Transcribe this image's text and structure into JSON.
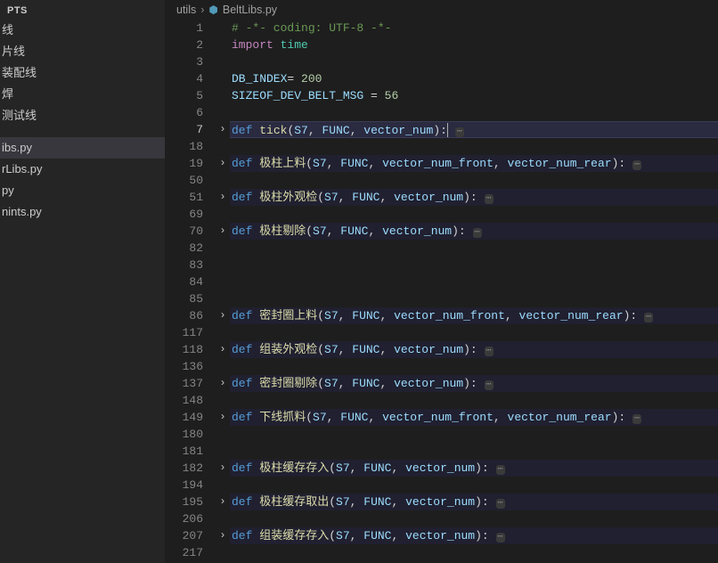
{
  "sidebar": {
    "header": "PTS",
    "items": [
      {
        "label": "线"
      },
      {
        "label": "片线"
      },
      {
        "label": "装配线"
      },
      {
        "label": "焊"
      },
      {
        "label": "测试线"
      },
      {
        "label": "ibs.py",
        "selected": true
      },
      {
        "label": "rLibs.py"
      },
      {
        "label": "py"
      },
      {
        "label": "nints.py"
      }
    ]
  },
  "breadcrumb": {
    "parent": "utils",
    "file": "BeltLibs.py"
  },
  "editor": {
    "lines": [
      {
        "n": 1,
        "type": "comment",
        "text": "# -*- coding: UTF-8 -*-"
      },
      {
        "n": 2,
        "type": "import",
        "kw": "import",
        "mod": "time"
      },
      {
        "n": 3,
        "type": "blank"
      },
      {
        "n": 4,
        "type": "assign",
        "var": "DB_INDEX",
        "val": "200",
        "op": "= "
      },
      {
        "n": 5,
        "type": "assign",
        "var": "SIZEOF_DEV_BELT_MSG",
        "val": "56",
        "op": " = "
      },
      {
        "n": 6,
        "type": "blank"
      },
      {
        "n": 7,
        "type": "def",
        "name": "tick",
        "params": "S7, FUNC, vector_num",
        "fold": true,
        "hl": true,
        "cursor": true
      },
      {
        "n": 18,
        "type": "blank"
      },
      {
        "n": 19,
        "type": "def",
        "name": "极柱上料",
        "params": "S7, FUNC, vector_num_front, vector_num_rear",
        "fold": true,
        "hl2": true
      },
      {
        "n": 50,
        "type": "blank"
      },
      {
        "n": 51,
        "type": "def",
        "name": "极柱外观检",
        "params": "S7, FUNC, vector_num",
        "fold": true,
        "hl2": true
      },
      {
        "n": 69,
        "type": "blank"
      },
      {
        "n": 70,
        "type": "def",
        "name": "极柱剔除",
        "params": "S7, FUNC, vector_num",
        "fold": true,
        "hl2": true
      },
      {
        "n": 82,
        "type": "blank"
      },
      {
        "n": 83,
        "type": "blank"
      },
      {
        "n": 84,
        "type": "blank"
      },
      {
        "n": 85,
        "type": "blank"
      },
      {
        "n": 86,
        "type": "def",
        "name": "密封圈上料",
        "params": "S7, FUNC, vector_num_front, vector_num_rear",
        "fold": true,
        "hl2": true
      },
      {
        "n": 117,
        "type": "blank"
      },
      {
        "n": 118,
        "type": "def",
        "name": "组装外观检",
        "params": "S7, FUNC, vector_num",
        "fold": true,
        "hl2": true
      },
      {
        "n": 136,
        "type": "blank"
      },
      {
        "n": 137,
        "type": "def",
        "name": "密封圈剔除",
        "params": "S7, FUNC, vector_num",
        "fold": true,
        "hl2": true
      },
      {
        "n": 148,
        "type": "blank"
      },
      {
        "n": 149,
        "type": "def",
        "name": "下线抓料",
        "params": "S7, FUNC, vector_num_front, vector_num_rear",
        "fold": true,
        "hl2": true
      },
      {
        "n": 180,
        "type": "blank"
      },
      {
        "n": 181,
        "type": "blank"
      },
      {
        "n": 182,
        "type": "def",
        "name": "极柱缓存存入",
        "params": "S7, FUNC, vector_num",
        "fold": true,
        "hl2": true
      },
      {
        "n": 194,
        "type": "blank"
      },
      {
        "n": 195,
        "type": "def",
        "name": "极柱缓存取出",
        "params": "S7, FUNC, vector_num",
        "fold": true,
        "hl2": true
      },
      {
        "n": 206,
        "type": "blank"
      },
      {
        "n": 207,
        "type": "def",
        "name": "组装缓存存入",
        "params": "S7, FUNC, vector_num",
        "fold": true,
        "hl2": true
      },
      {
        "n": 217,
        "type": "blank"
      }
    ]
  }
}
